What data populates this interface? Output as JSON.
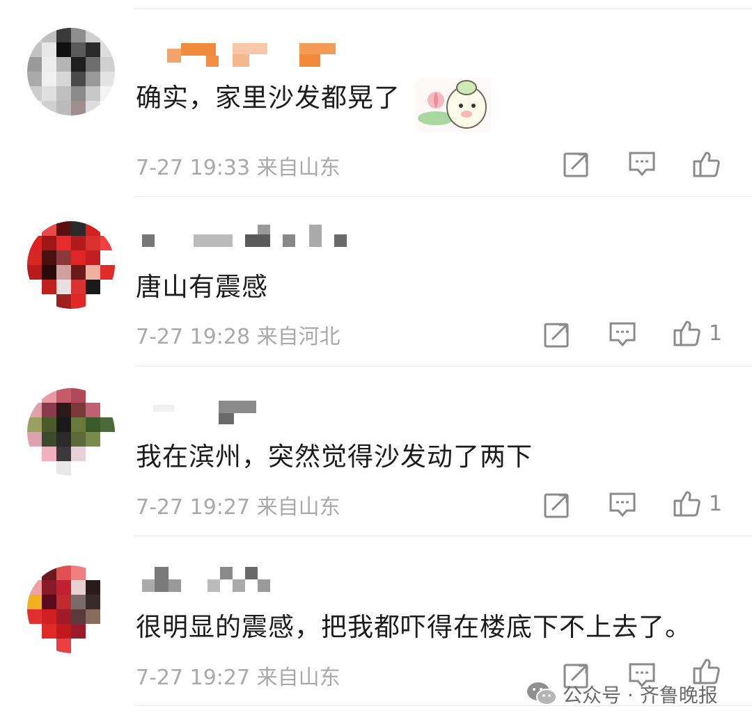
{
  "comments": [
    {
      "text": "确实，家里沙发都晃了",
      "time": "7-27 19:33",
      "location": "来自山东",
      "likes": "",
      "has_sticker": true
    },
    {
      "text": "唐山有震感",
      "time": "7-27 19:28",
      "location": "来自河北",
      "likes": "1",
      "has_sticker": false
    },
    {
      "text": "我在滨州，突然觉得沙发动了两下",
      "time": "7-27 19:27",
      "location": "来自山东",
      "likes": "1",
      "has_sticker": false
    },
    {
      "text": "很明显的震感，把我都吓得在楼底下不上去了。",
      "time": "7-27 19:27",
      "location": "来自山东",
      "likes": "",
      "has_sticker": false
    }
  ],
  "icons": {
    "repost": "repost-icon",
    "comment": "comment-icon",
    "like": "like-icon",
    "wechat": "wechat-icon"
  },
  "watermark": {
    "text": "公众号 · 齐鲁晚报"
  },
  "colors": {
    "text": "#1c1c1c",
    "meta": "#a9a9a9",
    "icon": "#8a8a8a",
    "divider": "#ececec"
  }
}
